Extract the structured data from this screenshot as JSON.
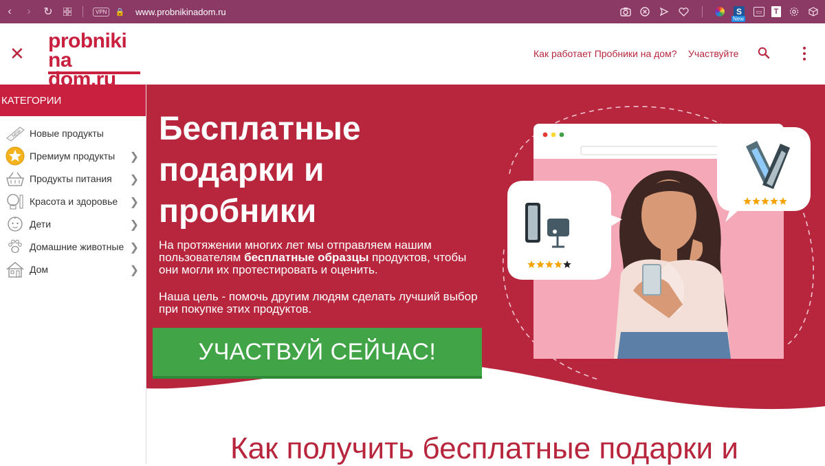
{
  "browser": {
    "url": "www.probnikinadom.ru",
    "vpn_label": "VPN",
    "extension_new_badge": "New"
  },
  "header": {
    "logo_line1": "probniki",
    "logo_line2": "na dom.ru",
    "nav_links": [
      "Как работает Пробники на дом?",
      "Участвуйте"
    ]
  },
  "sidebar": {
    "title": "КАТЕГОРИИ",
    "items": [
      {
        "label": "Новые продукты",
        "icon": "new-tag-icon",
        "has_children": false
      },
      {
        "label": "Премиум продукты",
        "icon": "star-icon",
        "has_children": true
      },
      {
        "label": "Продукты питания",
        "icon": "food-basket-icon",
        "has_children": true
      },
      {
        "label": "Красота и здоровье",
        "icon": "cosmetics-icon",
        "has_children": true
      },
      {
        "label": "Дети",
        "icon": "baby-face-icon",
        "has_children": true
      },
      {
        "label": "Домашние животные",
        "icon": "paw-icon",
        "has_children": true
      },
      {
        "label": "Дом",
        "icon": "house-icon",
        "has_children": true
      }
    ]
  },
  "hero": {
    "title_lines": [
      "Бесплатные",
      "подарки и",
      "пробники"
    ],
    "paragraph1_before": "На протяжении многих лет мы отправляем нашим пользователям ",
    "paragraph1_bold": "бесплатные образцы",
    "paragraph1_after": " продуктов, чтобы они могли их протестировать и оценить.",
    "paragraph2": "Наша цель - помочь другим людям сделать лучший выбор при покупке этих продуктов.",
    "cta_label": "УЧАСТВУЙ СЕЙЧАС!",
    "review_left_stars": 4,
    "review_right_stars": 5
  },
  "section": {
    "title": "Как получить бесплатные подарки и"
  },
  "colors": {
    "brand": "#c8203e",
    "hero_bg": "#b8263d",
    "cta": "#41a548",
    "browser_chrome": "#8b3a66"
  }
}
